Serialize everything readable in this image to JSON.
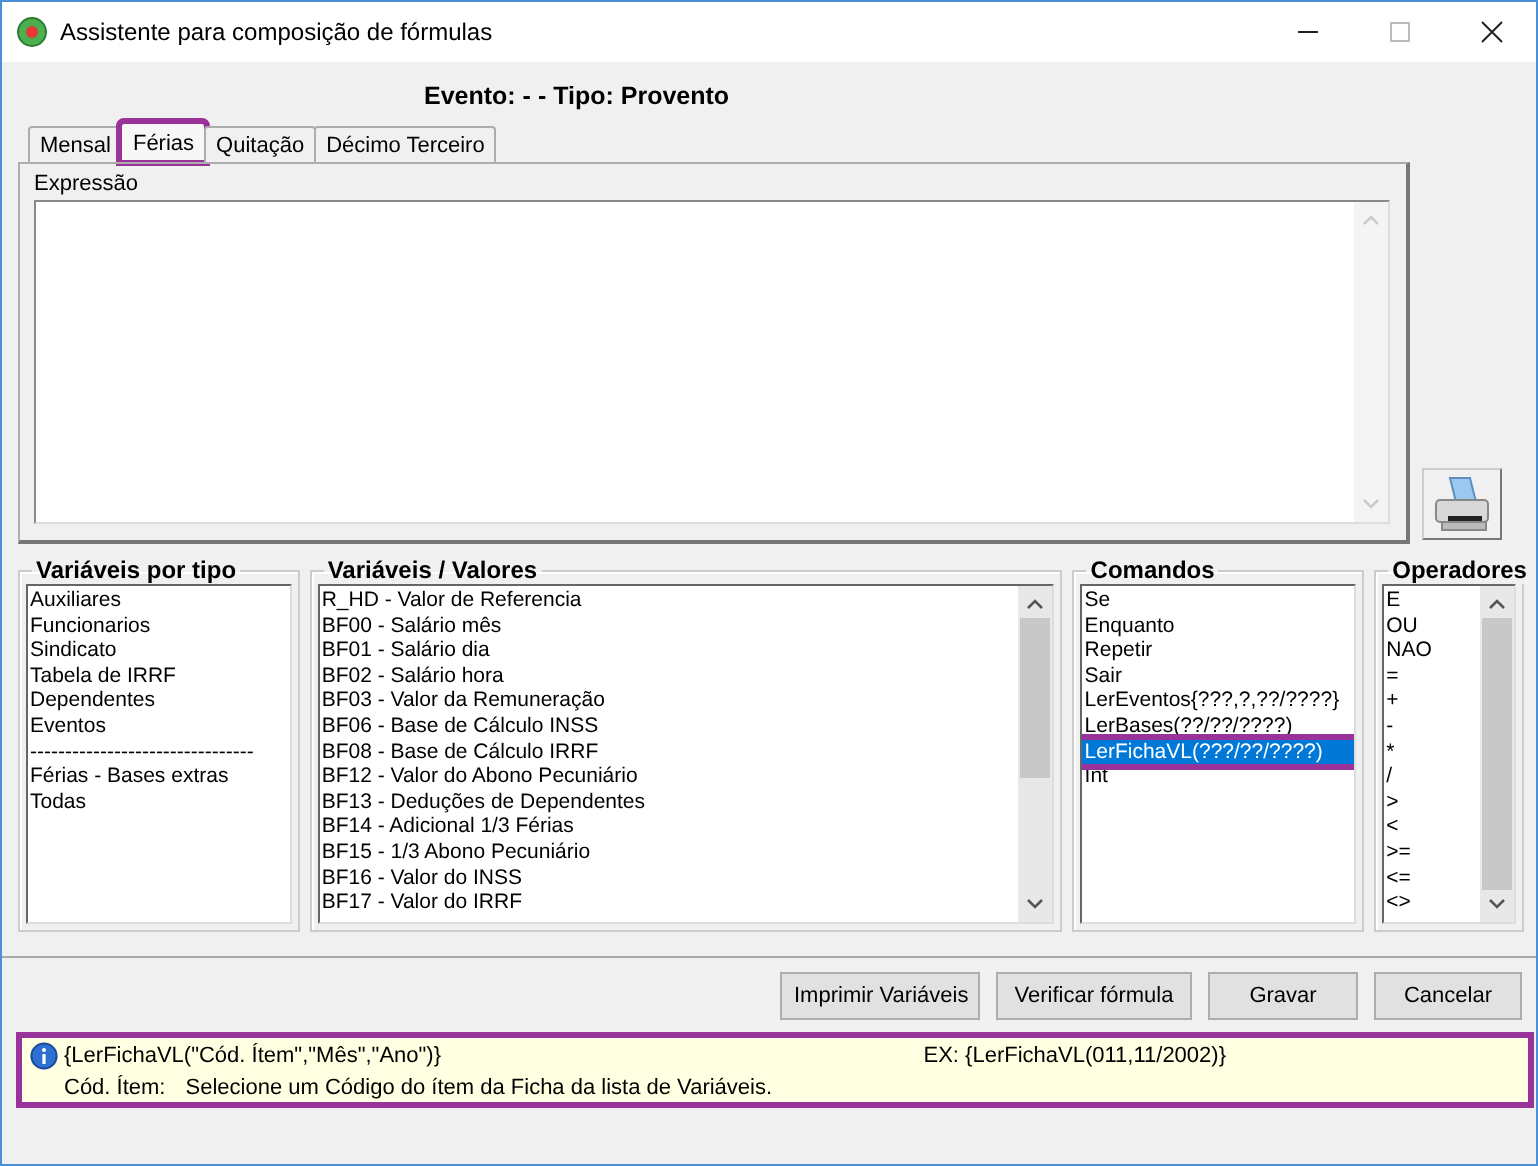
{
  "window": {
    "title": "Assistente para composição de fórmulas"
  },
  "header": "Evento:  -  - Tipo: Provento",
  "tabs": [
    {
      "label": "Mensal",
      "selected": false,
      "highlighted": false
    },
    {
      "label": "Férias",
      "selected": true,
      "highlighted": true
    },
    {
      "label": "Quitação",
      "selected": false,
      "highlighted": false
    },
    {
      "label": "Décimo Terceiro",
      "selected": false,
      "highlighted": false
    }
  ],
  "expression": {
    "label": "Expressão"
  },
  "variable_types": {
    "title": "Variáveis por tipo",
    "items": [
      "Auxiliares",
      "Funcionarios",
      "Sindicato",
      "Tabela de IRRF",
      "Dependentes",
      "Eventos",
      "--------------------------------",
      "Férias - Bases extras",
      "Todas"
    ]
  },
  "variables": {
    "title": "Variáveis / Valores",
    "items": [
      "R_HD - Valor de Referencia",
      "BF00 - Salário mês",
      "BF01 - Salário dia",
      "BF02 - Salário hora",
      "BF03 - Valor da Remuneração",
      "BF06 - Base de Cálculo INSS",
      "BF08 - Base de Cálculo IRRF",
      "BF12 - Valor do Abono Pecuniário",
      "BF13 - Deduções de Dependentes",
      "BF14 - Adicional 1/3 Férias",
      "BF15 - 1/3 Abono Pecuniário",
      "BF16 - Valor do INSS",
      "BF17 - Valor do IRRF"
    ]
  },
  "commands": {
    "title": "Comandos",
    "items": [
      {
        "label": "Se",
        "selected": false,
        "highlighted": false
      },
      {
        "label": "Enquanto",
        "selected": false,
        "highlighted": false
      },
      {
        "label": "Repetir",
        "selected": false,
        "highlighted": false
      },
      {
        "label": "Sair",
        "selected": false,
        "highlighted": false
      },
      {
        "label": "LerEventos{???,?,??/????}",
        "selected": false,
        "highlighted": false
      },
      {
        "label": "LerBases(??/??/????)",
        "selected": false,
        "highlighted": false
      },
      {
        "label": "LerFichaVL(???/??/????)",
        "selected": true,
        "highlighted": true
      },
      {
        "label": "Int",
        "selected": false,
        "highlighted": false
      }
    ]
  },
  "operators": {
    "title": "Operadores",
    "items": [
      "E",
      "OU",
      "NAO",
      "=",
      "+",
      "-",
      "*",
      "/",
      ">",
      "<",
      ">=",
      "<=",
      "<>"
    ]
  },
  "buttons": [
    "Imprimir Variáveis",
    "Verificar fórmula",
    "Gravar",
    "Cancelar"
  ],
  "hint": {
    "highlighted": true,
    "syntax": "{LerFichaVL(\"Cód. Ítem\",\"Mês\",\"Ano\")}",
    "example": "EX: {LerFichaVL(011,11/2002)}",
    "param_label": "Cód. Ítem:",
    "param_text": "Selecione um Código do ítem da Ficha da lista de Variáveis."
  }
}
